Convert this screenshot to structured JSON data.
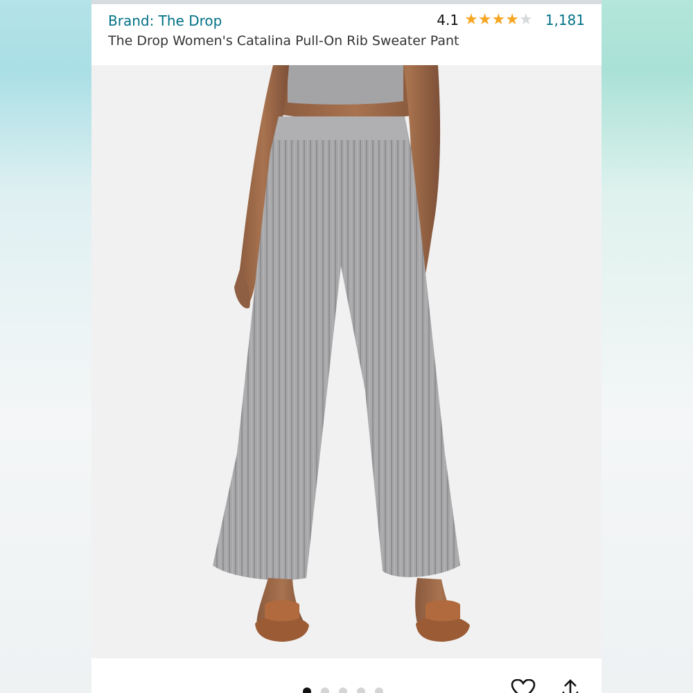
{
  "product": {
    "brand": "Brand: The Drop",
    "title": "The Drop Women's Catalina Pull-On Rib Sweater Pant",
    "rating": "4.1",
    "rating_value": 4.1,
    "stars_out_of": 5,
    "review_count": "1,181"
  },
  "gallery": {
    "image_count": 5,
    "active_index": 0,
    "image_description_icon": "product-photo"
  },
  "actions": {
    "favorite_icon": "heart-icon",
    "share_icon": "share-icon"
  },
  "colors": {
    "link": "#007185",
    "star": "#f5a623",
    "text": "#333333"
  }
}
